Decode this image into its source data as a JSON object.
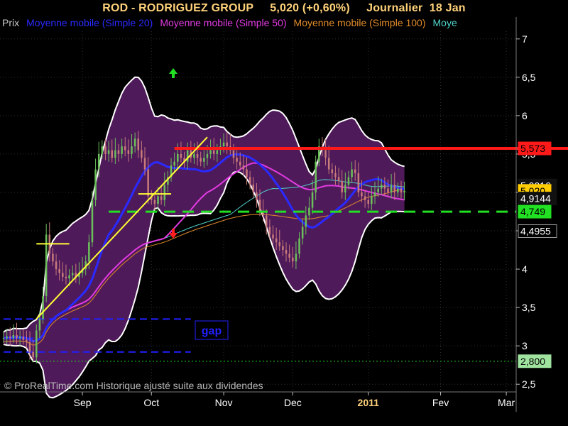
{
  "header": {
    "title": "ROD - RODRIGUEZ GROUP     5,020 (+0,60%)     Journalier  18 Jan"
  },
  "legend": {
    "items": [
      {
        "label": "Prix",
        "color": "#c8c8c8"
      },
      {
        "label": "Moyenne mobile (Simple 20)",
        "color": "#2a2aff"
      },
      {
        "label": "Moyenne mobile (Simple 50)",
        "color": "#e23be2"
      },
      {
        "label": "Moyenne mobile (Simple 100)",
        "color": "#e08a2a"
      },
      {
        "label": "Moye",
        "color": "#4fd1c8"
      }
    ]
  },
  "watermark": "© ProRealTime.com Historique ajusté suite aux dividendes",
  "annotations": {
    "gap_label": "gap"
  },
  "colors": {
    "background": "#000000",
    "bollinger_fill": "#4f1a5a",
    "bollinger_edge": "#ffffff",
    "sma20": "#2a2aff",
    "sma50": "#e23be2",
    "sma100": "#e08a2a",
    "sma_other": "#4fd1c8",
    "resistance": "#ff1a1a",
    "support": "#22e022",
    "trendline": "#ffff33",
    "gap_lines": "#2020ff",
    "candle_up": "#6bbf5a",
    "candle_down": "#c77a7a",
    "grid": "#ffffff"
  },
  "chart_data": {
    "type": "candlestick",
    "title": "ROD - RODRIGUEZ GROUP",
    "last_value": "5,020",
    "change": "+0,60%",
    "period": "Journalier",
    "date": "18 Jan",
    "ylim": [
      2.4,
      7.1
    ],
    "y_ticks": [
      "7",
      "6,5",
      "6",
      "5,5",
      "5",
      "4,5",
      "4",
      "3,5",
      "3",
      "2,5"
    ],
    "y_tick_values": [
      7,
      6.5,
      6,
      5.5,
      5,
      4.5,
      4,
      3.5,
      3,
      2.5
    ],
    "x_ticks": [
      {
        "label": "Sep",
        "index": 24,
        "year": false
      },
      {
        "label": "Oct",
        "index": 45,
        "year": false
      },
      {
        "label": "Nov",
        "index": 67,
        "year": false
      },
      {
        "label": "Dec",
        "index": 88,
        "year": false
      },
      {
        "label": "2011",
        "index": 111,
        "year": true
      },
      {
        "label": "Fev",
        "index": 133,
        "year": false
      },
      {
        "label": "Mar",
        "index": 153,
        "year": false
      }
    ],
    "x_range": [
      0,
      156
    ],
    "close_series": [
      3.1,
      3.12,
      3.1,
      3.14,
      3.1,
      3.12,
      3.08,
      3.05,
      2.92,
      2.85,
      3.2,
      3.35,
      3.65,
      4.45,
      4.2,
      4.1,
      4.0,
      3.95,
      3.9,
      3.88,
      3.92,
      3.95,
      3.9,
      3.95,
      4.0,
      4.1,
      4.35,
      4.9,
      5.3,
      5.5,
      5.6,
      5.5,
      5.55,
      5.45,
      5.55,
      5.5,
      5.6,
      5.55,
      5.5,
      5.6,
      5.7,
      5.55,
      5.45,
      5.3,
      4.95,
      4.9,
      4.85,
      4.95,
      4.9,
      5.1,
      5.2,
      5.35,
      5.4,
      5.5,
      5.45,
      5.4,
      5.55,
      5.45,
      5.5,
      5.45,
      5.4,
      5.45,
      5.5,
      5.55,
      5.5,
      5.55,
      5.6,
      5.65,
      5.6,
      5.55,
      5.45,
      5.4,
      5.35,
      5.3,
      5.2,
      5.1,
      5.0,
      4.9,
      4.75,
      4.7,
      4.55,
      4.45,
      4.4,
      4.35,
      4.3,
      4.25,
      4.2,
      4.15,
      4.1,
      4.2,
      4.4,
      4.55,
      4.7,
      4.8,
      5.0,
      5.4,
      5.6,
      5.55,
      5.45,
      5.3,
      5.25,
      5.2,
      5.15,
      5.0,
      5.1,
      5.2,
      5.3,
      5.25,
      5.0,
      4.95,
      4.9,
      4.85,
      4.95,
      5.0,
      5.05,
      5.1,
      5.05,
      5.0,
      5.1,
      5.0,
      5.05,
      5.0,
      5.02
    ],
    "indicator_labels": [
      {
        "text": "5,573",
        "value": 5.573,
        "bg": "#ff1a1a",
        "fg": "#000000"
      },
      {
        "text": "5,0016",
        "value": 5.09,
        "bg": "#111111",
        "fg": "#ffffff"
      },
      {
        "text": "5,020",
        "value": 5.02,
        "bg": "#ffcc00",
        "fg": "#000000"
      },
      {
        "text": "4,9144",
        "value": 4.92,
        "bg": "#111111",
        "fg": "#ffffff"
      },
      {
        "text": "4,749",
        "value": 4.749,
        "bg": "#22e022",
        "fg": "#000000"
      },
      {
        "text": "4,4955",
        "value": 4.4955,
        "bg": "#000000",
        "fg": "#ffffff"
      },
      {
        "text": "2,800",
        "value": 2.8,
        "bg": "#9fe39f",
        "fg": "#000000"
      }
    ],
    "levels": {
      "resistance": 5.573,
      "support": 4.749,
      "dotted": 2.8
    }
  }
}
